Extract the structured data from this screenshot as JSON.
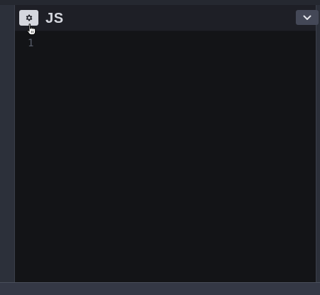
{
  "editor": {
    "language": "JS",
    "line_numbers": [
      "1"
    ],
    "icons": {
      "settings": "gear-icon",
      "collapse": "chevron-down-icon",
      "pointer": "hand-pointer-icon"
    }
  },
  "colors": {
    "header_bg": "#1e1f26",
    "body_bg": "#131417",
    "frame_bg": "#2c303a",
    "settings_button_bg": "#d5d7de",
    "collapse_button_bg": "#444857",
    "label_text": "#d5d7de",
    "line_number_text": "#5a5f6b"
  }
}
